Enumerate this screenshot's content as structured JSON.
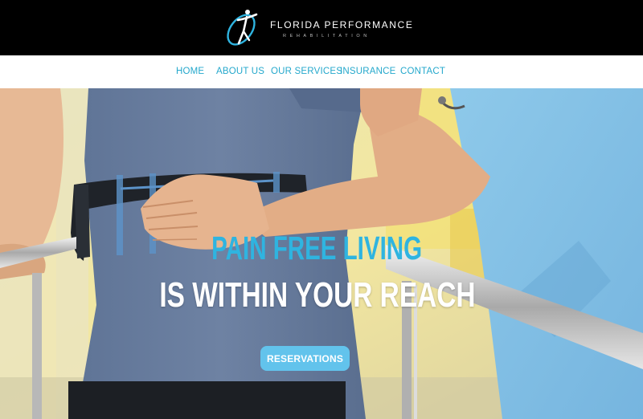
{
  "brand": {
    "name": "FLORIDA PERFORMANCE",
    "tagline": "REHABILITATION",
    "logo_icon": "figure-swoosh-icon",
    "colors": {
      "accent": "#24a8cc",
      "headline_blue": "#2fb4e0",
      "button": "#62c3ec",
      "header_bg": "#000000"
    }
  },
  "nav": {
    "items": [
      {
        "label": "HOME"
      },
      {
        "label": "ABOUT US"
      },
      {
        "label": "OUR SERVICES"
      },
      {
        "label": "INSURANCE"
      },
      {
        "label": "CONTACT"
      }
    ]
  },
  "hero": {
    "headline_line1": "PAIN FREE LIVING",
    "headline_line2": "IS WITHIN YOUR REACH",
    "cta_label": "RESERVATIONS"
  }
}
